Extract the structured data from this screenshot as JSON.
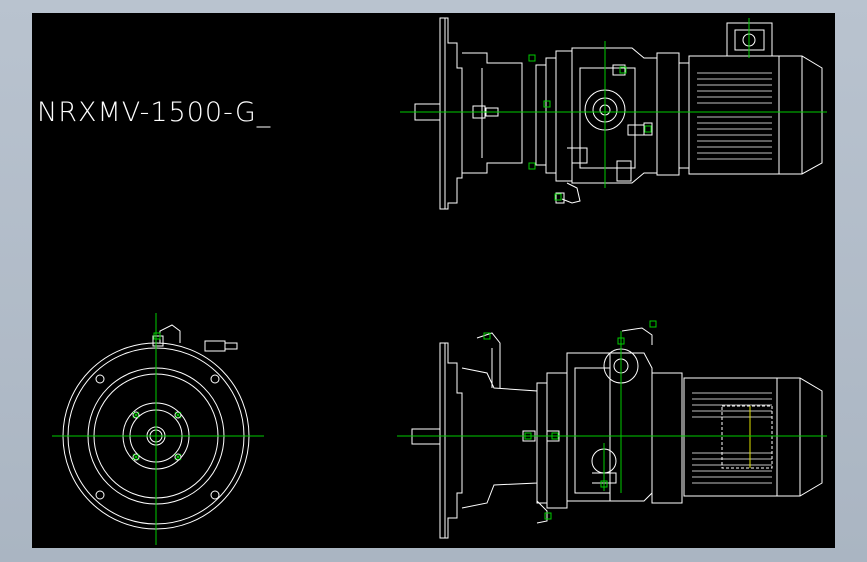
{
  "drawing": {
    "title": "NRXMV-1500-G_"
  },
  "colors": {
    "background": "#000000",
    "frame": "#b3bdc9",
    "line": "#ffffff",
    "centerline": "#00cc00"
  }
}
